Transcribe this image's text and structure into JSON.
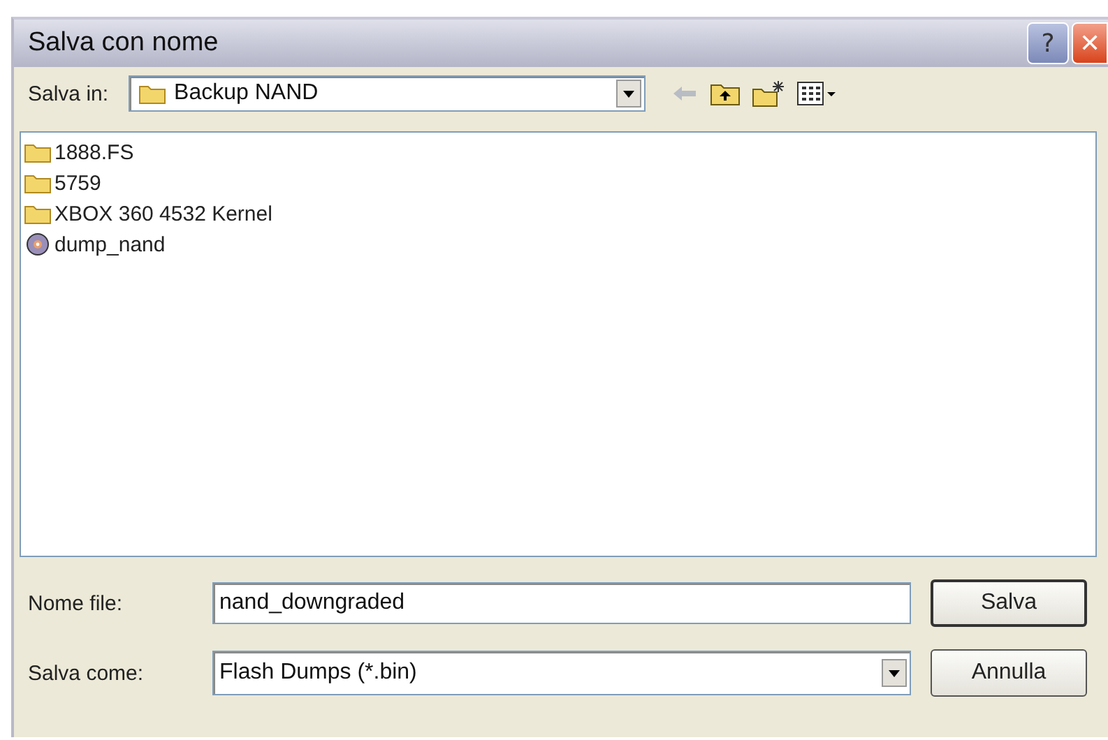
{
  "window": {
    "title": "Salva con nome"
  },
  "title_buttons": [
    {
      "kind": "help",
      "label": "?"
    },
    {
      "kind": "close",
      "label": "✕"
    }
  ],
  "location": {
    "label": "Salva in:",
    "value": "Backup NAND"
  },
  "files": [
    {
      "kind": "folder",
      "name": "1888.FS"
    },
    {
      "kind": "folder",
      "name": "5759"
    },
    {
      "kind": "folder",
      "name": "XBOX 360 4532 Kernel"
    },
    {
      "kind": "disc",
      "name": "dump_nand"
    }
  ],
  "filename": {
    "label": "Nome file:",
    "value": "nand_downgraded"
  },
  "filetype": {
    "label": "Salva come:",
    "value": "Flash Dumps (*.bin)"
  },
  "buttons": [
    "Salva",
    "Annulla"
  ]
}
